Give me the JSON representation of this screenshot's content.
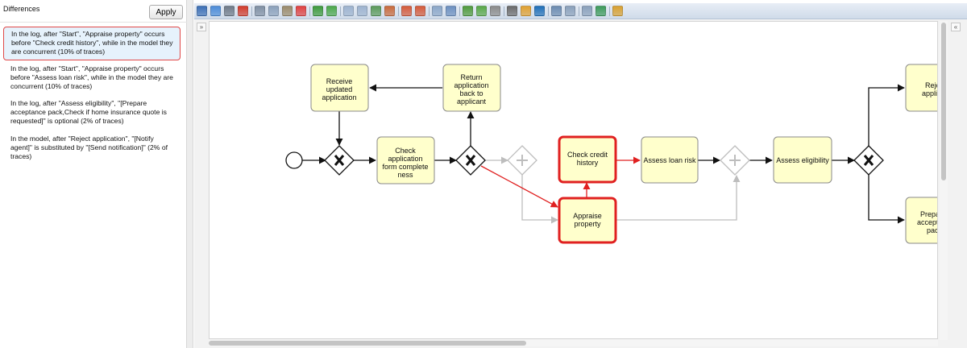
{
  "left_panel": {
    "title": "Differences",
    "apply_label": "Apply",
    "items": [
      "In the log, after \"Start\", \"Appraise property\" occurs before \"Check credit history\", while in the model they are concurrent (10% of traces)",
      "In the log, after \"Start\", \"Appraise property\" occurs before \"Assess loan risk\", while in the model they are concurrent (10% of traces)",
      "In the log, after \"Assess eligibility\", \"[Prepare acceptance pack,Check if home insurance quote is requested]\" is optional (2% of traces)",
      "In the model, after \"Reject application\", \"[Notify agent]\" is substituted by \"[Send notification]\" (2% of traces)"
    ]
  },
  "toolbar": {
    "icons": [
      {
        "name": "save-icon",
        "color": "#3b6fb6"
      },
      {
        "name": "save-as-icon",
        "color": "#4a8bd8"
      },
      {
        "name": "print-icon",
        "color": "#6f7a88"
      },
      {
        "name": "pdf-icon",
        "color": "#d23b2b"
      },
      {
        "name": "cut-icon",
        "color": "#7f8fa3"
      },
      {
        "name": "copy-icon",
        "color": "#8aa0bb"
      },
      {
        "name": "paste-icon",
        "color": "#9a8a6a"
      },
      {
        "name": "delete-icon",
        "color": "#e04040"
      },
      {
        "name": "undo-icon",
        "color": "#3c9a3c"
      },
      {
        "name": "redo-icon",
        "color": "#4aa84a"
      },
      {
        "name": "align-icon",
        "color": "#9db3cf"
      },
      {
        "name": "distribute-icon",
        "color": "#9db3cf"
      },
      {
        "name": "group-icon",
        "color": "#5a9a5a"
      },
      {
        "name": "ungroup-icon",
        "color": "#c86a3c"
      },
      {
        "name": "add-docker-icon",
        "color": "#d45a3a"
      },
      {
        "name": "remove-docker-icon",
        "color": "#d45a3a"
      },
      {
        "name": "edit-icon",
        "color": "#8aa6c8"
      },
      {
        "name": "properties-icon",
        "color": "#6b8fc0"
      },
      {
        "name": "layout-icon",
        "color": "#4e9a3c"
      },
      {
        "name": "shape-icon",
        "color": "#58a848"
      },
      {
        "name": "clock-icon",
        "color": "#8a8a8a"
      },
      {
        "name": "view-icon",
        "color": "#6a6a6a"
      },
      {
        "name": "rainbow-icon",
        "color": "#e0a030"
      },
      {
        "name": "bpmn-icon",
        "color": "#1f6fb8"
      },
      {
        "name": "play-icon",
        "color": "#6a8ab0"
      },
      {
        "name": "doc-icon",
        "color": "#8aa0bb"
      },
      {
        "name": "doc-menu-icon",
        "color": "#8aa0bb"
      },
      {
        "name": "export-icon",
        "color": "#3c9a5a"
      },
      {
        "name": "paint-icon",
        "color": "#d8a030"
      }
    ]
  },
  "diagram": {
    "tasks": {
      "receive": "Receive updated application",
      "return": "Return application back to applicant",
      "check_form": "Check application form complete ness",
      "check_credit": "Check credit history",
      "appraise": "Appraise property",
      "assess_risk": "Assess loan risk",
      "assess_elig": "Assess eligibility",
      "reject": "Reje applica",
      "prepare": "Prepa accepta pac"
    },
    "colors": {
      "task_fill": "#ffffcc",
      "task_stroke": "#8a8a8a",
      "highlight": "#e02020",
      "faded": "#bdbdbd"
    }
  }
}
